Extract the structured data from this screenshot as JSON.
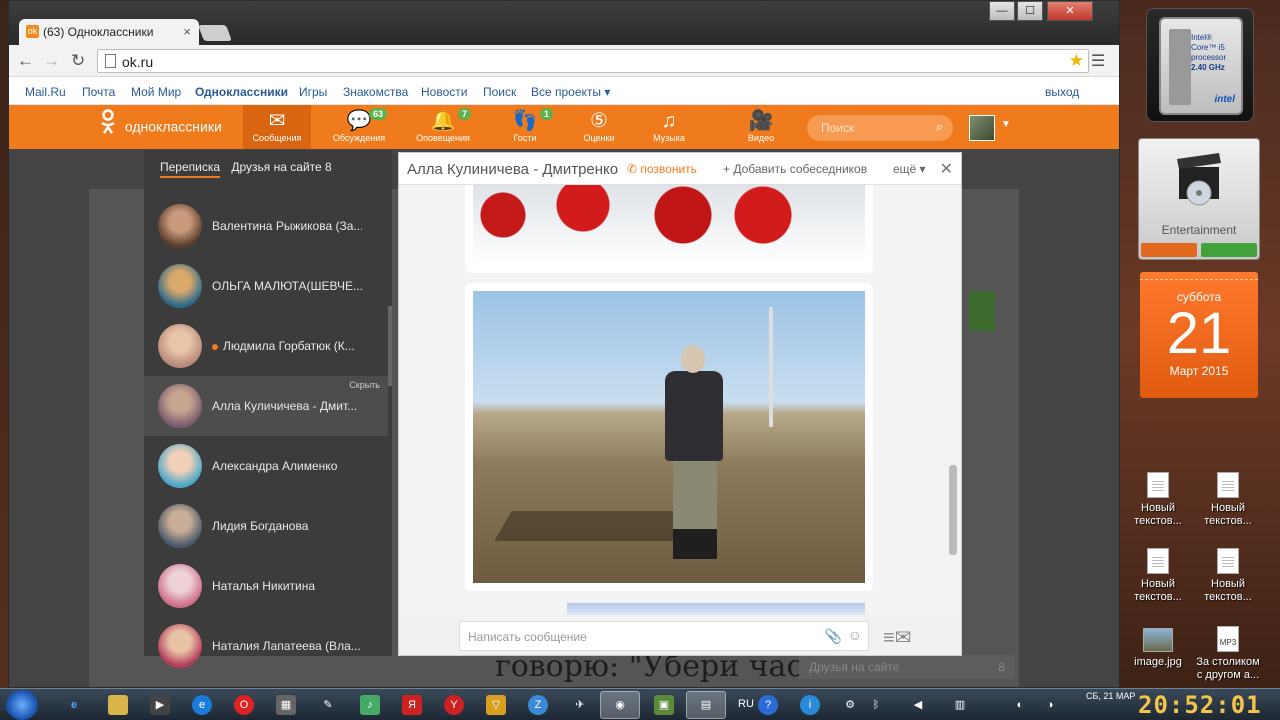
{
  "browser": {
    "tab_title": "(63) Одноклассники",
    "url": "ok.ru",
    "window_controls": {
      "minimize": "—",
      "maximize": "☐",
      "close": "✕"
    }
  },
  "mailbar": {
    "links": [
      "Mail.Ru",
      "Почта",
      "Мой Мир",
      "Одноклассники",
      "Игры",
      "Знакомства",
      "Новости",
      "Поиск",
      "Все проекты ▾"
    ],
    "logout": "выход"
  },
  "ok_nav": {
    "logo_text": "одноклассники",
    "items": [
      {
        "label": "Сообщения",
        "icon": "envelope-icon",
        "badge": ""
      },
      {
        "label": "Обсуждения",
        "icon": "chat-bubbles-icon",
        "badge": "63"
      },
      {
        "label": "Оповещения",
        "icon": "bell-icon",
        "badge": "7"
      },
      {
        "label": "Гости",
        "icon": "footprints-icon",
        "badge": "1"
      },
      {
        "label": "Оценки",
        "icon": "rating-icon",
        "badge": ""
      },
      {
        "label": "Музыка",
        "icon": "music-note-icon",
        "badge": ""
      },
      {
        "label": "Видео",
        "icon": "video-camera-icon",
        "badge": ""
      }
    ],
    "search_placeholder": "Поиск"
  },
  "conversations": {
    "tabs": [
      "Переписка",
      "Друзья на сайте 8"
    ],
    "items": [
      {
        "name": "Валентина Рыжикова (За..."
      },
      {
        "name": "ОЛЬГА МАЛЮТА(ШЕВЧЕ..."
      },
      {
        "name": "Людмила Горбатюк (К..."
      },
      {
        "name": "Алла Куличичева - Дмит...",
        "hide_label": "Скрыть"
      },
      {
        "name": "Александра Алименко"
      },
      {
        "name": "Лидия Богданова"
      },
      {
        "name": "Наталья Никитина"
      },
      {
        "name": "Наталия Лапатеева (Вла..."
      }
    ]
  },
  "chat": {
    "title": "Алла Кулиничева - Дмитренко",
    "call": "позвонить",
    "add_people": "Добавить собеседников",
    "more": "ещё ▾",
    "input_placeholder": "Написать сообщение"
  },
  "background_page": {
    "big_text": "говорю: \"Убери час",
    "friends_bar": "Друзья на сайте",
    "friends_count": "8"
  },
  "desktop": {
    "cpu": {
      "line1": "Intel®",
      "line2": "Core™ i5",
      "line3": "processor",
      "ghz": "2.40 GHz",
      "brand": "intel"
    },
    "entertainment_label": "Entertainment",
    "calendar": {
      "day": "суббота",
      "date": "21",
      "month": "Март 2015"
    },
    "icons": [
      {
        "label": "Новый текстов..."
      },
      {
        "label": "Новый текстов..."
      },
      {
        "label": "Новый текстов..."
      },
      {
        "label": "Новый текстов..."
      },
      {
        "label": "image.jpg"
      },
      {
        "label": "За столиком с другом а..."
      }
    ],
    "mp3_label": "MP3"
  },
  "taskbar": {
    "lang": "RU",
    "date_short": "СБ, 21 МАР",
    "time": "20:52:01"
  }
}
